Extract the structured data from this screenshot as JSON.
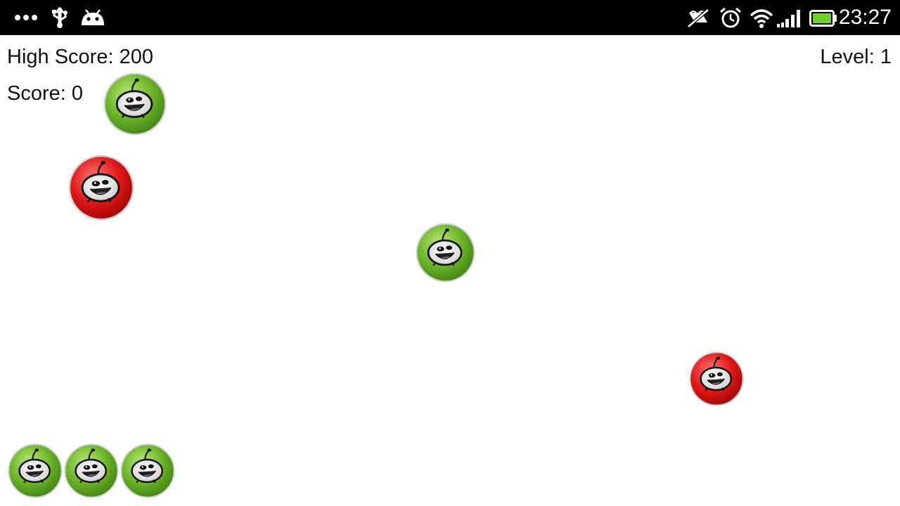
{
  "status_bar": {
    "time": "23:27",
    "left_icons": [
      "more-dots-icon",
      "usb-icon",
      "android-debug-icon"
    ],
    "right_icons": [
      "mute-icon",
      "alarm-icon",
      "wifi-icon",
      "signal-icon",
      "battery-icon"
    ],
    "battery_color": "#6fd12b"
  },
  "hud": {
    "high_score": "High Score: 200",
    "score": "Score: 0",
    "level": "Level: 1"
  },
  "colors": {
    "green_bug": "#5fa820",
    "red_bug": "#dd1111"
  },
  "bugs": [
    {
      "kind": "green"
    },
    {
      "kind": "red"
    },
    {
      "kind": "green"
    },
    {
      "kind": "red"
    }
  ],
  "lives": {
    "count": 3,
    "kind": "green"
  }
}
